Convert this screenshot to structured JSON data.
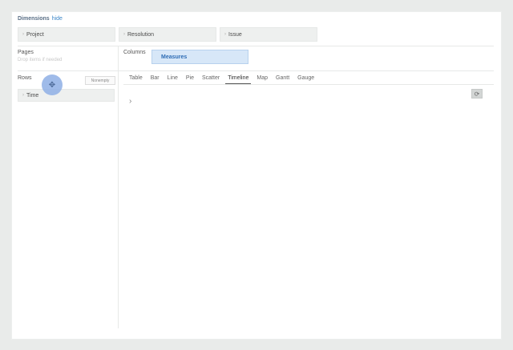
{
  "dimensions": {
    "title": "Dimensions",
    "hide_link": "hide",
    "items": [
      {
        "label": "Project"
      },
      {
        "label": "Resolution"
      },
      {
        "label": "Issue"
      }
    ]
  },
  "pages": {
    "label": "Pages",
    "hint": "Drop items if needed"
  },
  "columns": {
    "label": "Columns",
    "measures": "Measures"
  },
  "rows": {
    "label": "Rows",
    "nonempty_button": "Nonempty",
    "time_item": "Time"
  },
  "tabs": [
    "Table",
    "Bar",
    "Line",
    "Pie",
    "Scatter",
    "Timeline",
    "Map",
    "Gantt",
    "Gauge"
  ],
  "active_tab": "Timeline",
  "icons": {
    "refresh": "refresh-icon",
    "expand": "chevron-right-icon",
    "move": "move-cursor-icon"
  }
}
